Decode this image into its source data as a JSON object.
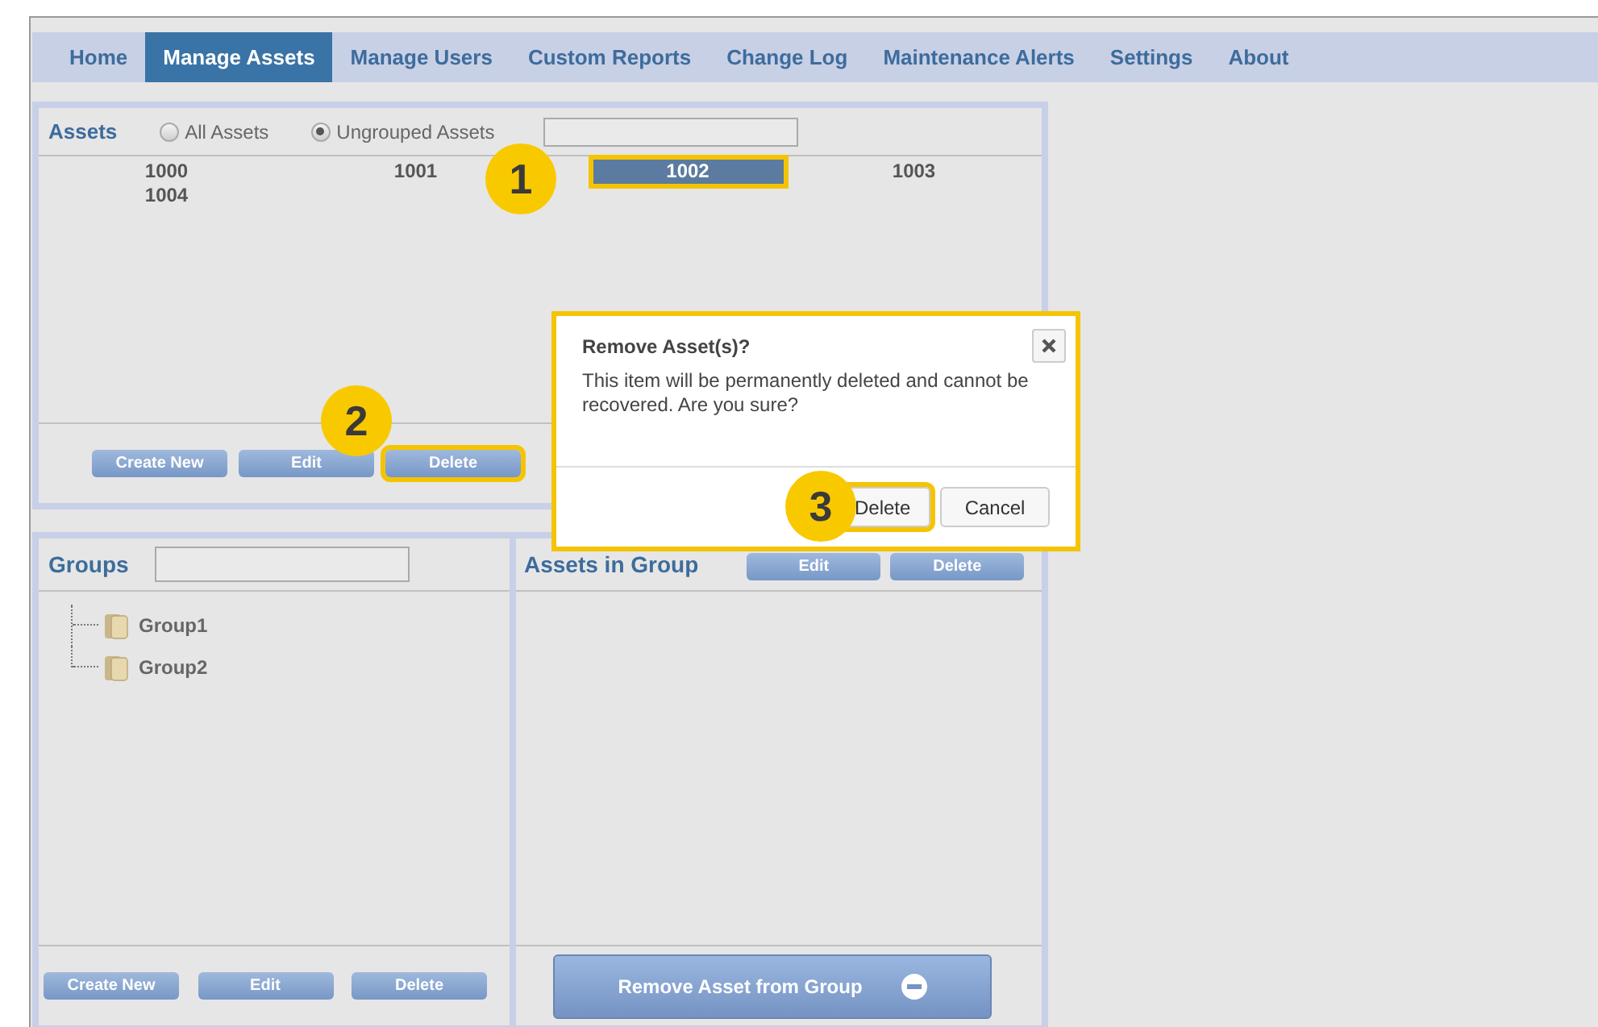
{
  "nav": [
    {
      "label": "Home",
      "selected": false
    },
    {
      "label": "Manage Assets",
      "selected": true
    },
    {
      "label": "Manage Users",
      "selected": false
    },
    {
      "label": "Custom Reports",
      "selected": false
    },
    {
      "label": "Change Log",
      "selected": false
    },
    {
      "label": "Maintenance Alerts",
      "selected": false
    },
    {
      "label": "Settings",
      "selected": false
    },
    {
      "label": "About",
      "selected": false
    }
  ],
  "assets": {
    "title": "Assets",
    "filters": [
      {
        "label": "All Assets",
        "selected": false
      },
      {
        "label": "Ungrouped Assets",
        "selected": true
      }
    ],
    "items": [
      {
        "label": "1000",
        "selected": false
      },
      {
        "label": "1001",
        "selected": false
      },
      {
        "label": "1002",
        "selected": true,
        "callout": "1"
      },
      {
        "label": "1003",
        "selected": false
      },
      {
        "label": "1004",
        "selected": false
      }
    ],
    "buttons": [
      {
        "label": "Create New"
      },
      {
        "label": "Edit"
      },
      {
        "label": "Delete",
        "callout": "2"
      }
    ]
  },
  "groups": {
    "title": "Groups",
    "tree": [
      {
        "label": "Group1"
      },
      {
        "label": "Group2"
      }
    ],
    "buttons": [
      {
        "label": "Create New"
      },
      {
        "label": "Edit"
      },
      {
        "label": "Delete"
      }
    ]
  },
  "assets_in_group": {
    "title": "Assets in Group",
    "buttons": [
      {
        "label": "Edit"
      },
      {
        "label": "Delete"
      }
    ],
    "remove_button": "Remove Asset from Group"
  },
  "dialog": {
    "title": "Remove Asset(s)?",
    "message": "This item will be permanently deleted and cannot be recovered. Are you sure?",
    "buttons": [
      {
        "label": "Delete",
        "callout": "3"
      },
      {
        "label": "Cancel"
      }
    ]
  }
}
